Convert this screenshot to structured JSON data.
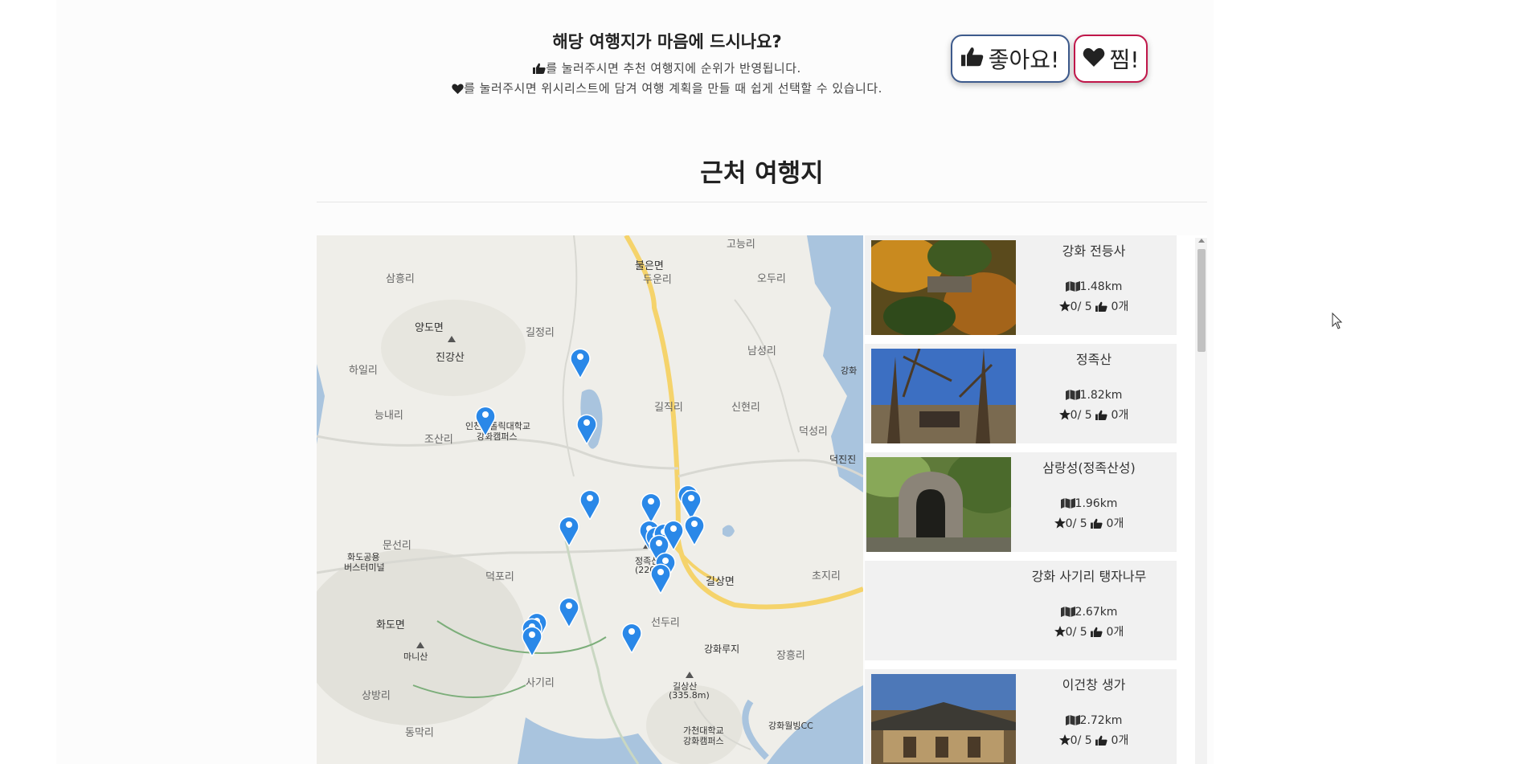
{
  "prompt": {
    "title": "해당 여행지가 마음에 드시나요?",
    "line1": "를 눌러주시면 추천 여행지에 순위가 반영됩니다.",
    "line2": "를 눌러주시면 위시리스트에 담겨 여행 계획을 만들 때 쉽게 선택할 수 있습니다."
  },
  "buttons": {
    "like_label": "좋아요!",
    "wish_label": "찜!"
  },
  "section": {
    "title": "근처 여행지"
  },
  "map": {
    "labels": {
      "sangheungri": "삼흥리",
      "yangdomyeon": "양도면",
      "jingangsan": "진강산",
      "hailri": "하일리",
      "neungnaeri": "능내리",
      "josanri": "조산리",
      "campus1": "인천가톨릭대학교",
      "campus1b": "강화캠퍼스",
      "gilgjeongri": "길정리",
      "buleunmyeon": "불은면",
      "dugunri": "두운리",
      "odu": "오두리",
      "goneungri": "고능리",
      "namseongri": "남성리",
      "gilgjikri": "길직리",
      "sinhyeonri": "신현리",
      "ganghwa": "강화",
      "deokseongri": "덕성리",
      "deokjinjin": "덕진진",
      "muneunri": "문선리",
      "hwado_terminal": "화도공용",
      "hwado_terminal2": "버스터미널",
      "deokporri": "덕포리",
      "hwadomyeon": "화도면",
      "manisan": "마니산",
      "sangbangri": "상방리",
      "dongmakri": "동막리",
      "sagiri": "사기리",
      "jeongjok": "정족산",
      "jeongjok_h": "(220m)",
      "gilsangmyeon": "길상면",
      "seonduri": "선두리",
      "ganghwaruji": "강화루지",
      "chojiri": "초지리",
      "jangheungri": "장흥리",
      "gilsangsan": "길상산",
      "gilsangsan_h": "(335.8m)",
      "gacheon": "가천대학교",
      "gacheon2": "강화캠퍼스",
      "ganghwacc": "강화월빙CC"
    }
  },
  "places": [
    {
      "name": "강화 전등사",
      "distance": "1.48km",
      "rating": "0/ 5",
      "likes": "0개"
    },
    {
      "name": "정족산",
      "distance": "1.82km",
      "rating": "0/ 5",
      "likes": "0개"
    },
    {
      "name": "삼랑성(정족산성)",
      "distance": "1.96km",
      "rating": "0/ 5",
      "likes": "0개"
    },
    {
      "name": "강화 사기리 탱자나무",
      "distance": "2.67km",
      "rating": "0/ 5",
      "likes": "0개"
    },
    {
      "name": "이건창 생가",
      "distance": "2.72km",
      "rating": "0/ 5",
      "likes": "0개"
    }
  ],
  "colors": {
    "like_border": "#3d5a8c",
    "wish_border": "#c0174a",
    "pin": "#2a88e8",
    "road": "#f5d36b",
    "sea": "#a9c4de"
  }
}
